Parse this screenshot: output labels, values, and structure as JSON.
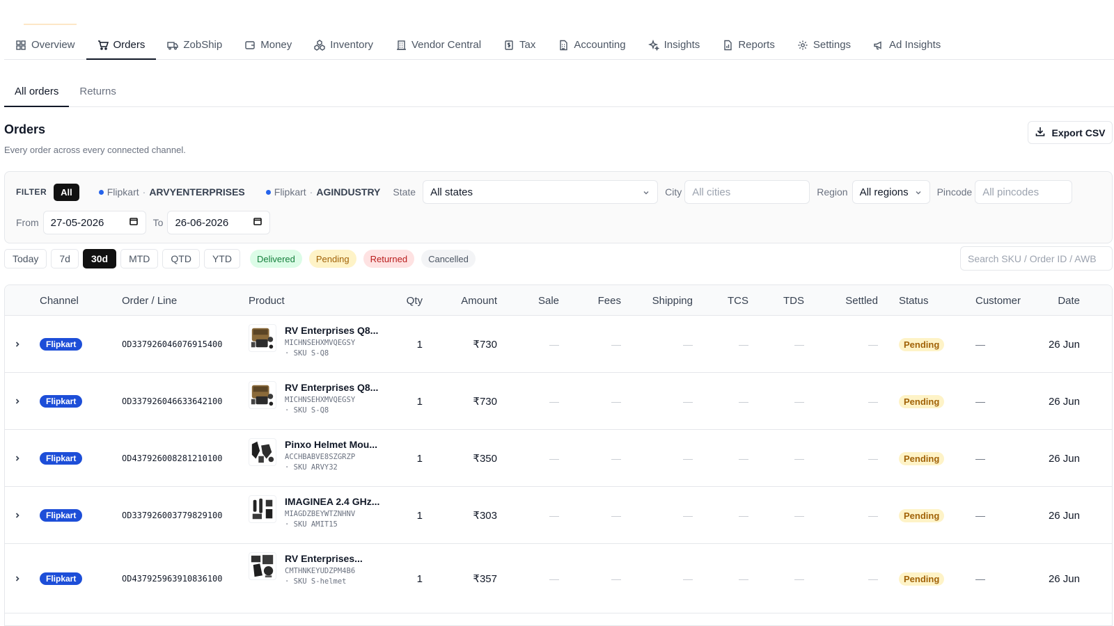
{
  "nav": {
    "tabs": [
      {
        "label": "Overview",
        "icon": "grid-icon"
      },
      {
        "label": "Orders",
        "icon": "cart-icon",
        "active": true
      },
      {
        "label": "ZobShip",
        "icon": "truck-icon"
      },
      {
        "label": "Money",
        "icon": "wallet-icon"
      },
      {
        "label": "Inventory",
        "icon": "boxes-icon"
      },
      {
        "label": "Vendor Central",
        "icon": "building-icon"
      },
      {
        "label": "Tax",
        "icon": "receipt-icon"
      },
      {
        "label": "Accounting",
        "icon": "calculator-icon"
      },
      {
        "label": "Insights",
        "icon": "sparkles-icon"
      },
      {
        "label": "Reports",
        "icon": "file-chart-icon"
      },
      {
        "label": "Settings",
        "icon": "gear-icon"
      },
      {
        "label": "Ad Insights",
        "icon": "megaphone-icon"
      }
    ]
  },
  "subtabs": [
    {
      "label": "All orders",
      "active": true
    },
    {
      "label": "Returns"
    }
  ],
  "header": {
    "title": "Orders",
    "subtitle": "Every order across every connected channel.",
    "export_label": "Export CSV"
  },
  "filters": {
    "label": "FILTER",
    "all_label": "All",
    "accounts": [
      {
        "channel": "Flipkart",
        "sep": "·",
        "name": "ARVYENTERPRISES"
      },
      {
        "channel": "Flipkart",
        "sep": "·",
        "name": "AGINDUSTRY"
      }
    ],
    "state_label": "State",
    "state_value": "All states",
    "city_label": "City",
    "city_placeholder": "All cities",
    "region_label": "Region",
    "region_value": "All regions",
    "pincode_label": "Pincode",
    "pincode_placeholder": "All pincodes",
    "from_label": "From",
    "from_value": "27-05-2026",
    "to_label": "To",
    "to_value": "26-06-2026"
  },
  "quick_ranges": [
    "Today",
    "7d",
    "30d",
    "MTD",
    "QTD",
    "YTD"
  ],
  "quick_active": "30d",
  "status_filters": {
    "delivered": "Delivered",
    "pending": "Pending",
    "returned": "Returned",
    "cancelled": "Cancelled"
  },
  "search": {
    "placeholder": "Search SKU / Order ID / AWB"
  },
  "table": {
    "columns": {
      "channel": "Channel",
      "order": "Order / Line",
      "product": "Product",
      "qty": "Qty",
      "amount": "Amount",
      "sale": "Sale",
      "fees": "Fees",
      "shipping": "Shipping",
      "tcs": "TCS",
      "tds": "TDS",
      "settled": "Settled",
      "status": "Status",
      "customer": "Customer",
      "date": "Date"
    },
    "rows": [
      {
        "channel": "Flipkart",
        "order_id": "OD337926046076915400",
        "product_name": "RV Enterprises Q8...",
        "product_code": "MICHNSEHXMVQEGSY",
        "sku": "· SKU S-Q8",
        "qty": "1",
        "amount": "₹730",
        "dash": "—",
        "status": "Pending",
        "date": "26 Jun",
        "thumb": "case"
      },
      {
        "channel": "Flipkart",
        "order_id": "OD337926046633642100",
        "product_name": "RV Enterprises Q8...",
        "product_code": "MICHNSEHXMVQEGSY",
        "sku": "· SKU S-Q8",
        "qty": "1",
        "amount": "₹730",
        "dash": "—",
        "status": "Pending",
        "date": "26 Jun",
        "thumb": "case"
      },
      {
        "channel": "Flipkart",
        "order_id": "OD437926008281210100",
        "product_name": "Pinxo Helmet Mou...",
        "product_code": "ACCHBABVE8SZGRZP",
        "sku": "· SKU ARVY32",
        "qty": "1",
        "amount": "₹350",
        "dash": "—",
        "status": "Pending",
        "date": "26 Jun",
        "thumb": "mount"
      },
      {
        "channel": "Flipkart",
        "order_id": "OD337926003779829100",
        "product_name": "IMAGINEA 2.4 GHz...",
        "product_code": "MIAGDZBEYWTZNHNV",
        "sku": "· SKU AMIT15",
        "qty": "1",
        "amount": "₹303",
        "dash": "—",
        "status": "Pending",
        "date": "26 Jun",
        "thumb": "mic"
      },
      {
        "channel": "Flipkart",
        "order_id": "OD437925963910836100",
        "product_name": "RV Enterprises...",
        "product_code": "CMTHNKEYUDZPM4B6",
        "sku": "· SKU S-helmet",
        "qty": "1",
        "amount": "₹357",
        "dash": "—",
        "status": "Pending",
        "date": "26 Jun",
        "thumb": "parts"
      }
    ]
  }
}
